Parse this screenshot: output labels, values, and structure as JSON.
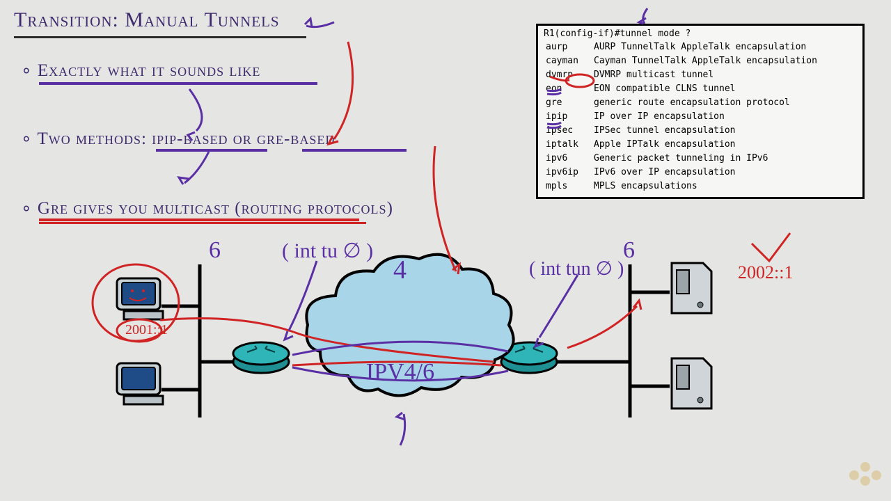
{
  "title": "Transition: Manual Tunnels",
  "bullets": {
    "b1": "Exactly what it sounds like",
    "b2": "Two methods: ipip-based or gre-based",
    "b3": "Gre gives you multicast (routing protocols)"
  },
  "cli": {
    "prompt": "R1(config-if)#tunnel mode ?",
    "rows": [
      {
        "k": "aurp",
        "d": "AURP TunnelTalk AppleTalk encapsulation"
      },
      {
        "k": "cayman",
        "d": "Cayman TunnelTalk AppleTalk encapsulation"
      },
      {
        "k": "dvmrp",
        "d": "DVMRP multicast tunnel"
      },
      {
        "k": "eon",
        "d": "EON compatible CLNS tunnel"
      },
      {
        "k": "gre",
        "d": "generic route encapsulation protocol"
      },
      {
        "k": "ipip",
        "d": "IP over IP encapsulation"
      },
      {
        "k": "ipsec",
        "d": "IPSec tunnel encapsulation"
      },
      {
        "k": "iptalk",
        "d": "Apple IPTalk encapsulation"
      },
      {
        "k": "ipv6",
        "d": "Generic packet tunneling in IPv6"
      },
      {
        "k": "ipv6ip",
        "d": "IPv6 over IP encapsulation"
      },
      {
        "k": "mpls",
        "d": "MPLS encapsulations"
      }
    ]
  },
  "diagram": {
    "left_six": "6",
    "right_six": "6",
    "four": "4",
    "cloud_label": "IPV4/6",
    "int_left": "( int tu ∅ )",
    "int_right": "( int tun ∅ )",
    "dest_addr": "2002::1",
    "src_addr": "2001::1"
  }
}
